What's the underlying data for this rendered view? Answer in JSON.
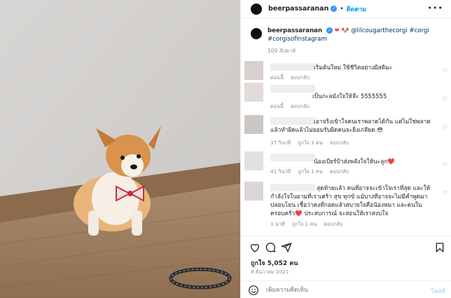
{
  "header": {
    "username": "beerpassaranan",
    "follow_label": "ติดตาม",
    "more_label": "•••"
  },
  "caption": {
    "username": "beerpassaranan",
    "text": " 🐶 @lilcougarthecorgi #corgi #corgisofinstagram",
    "time": "109 สัปดาห์"
  },
  "comments": [
    {
      "text": "เริ่มต้นใหม่ ใช้ชีวิตอย่างมีสติมะ",
      "time": "ตอนนี้",
      "likes": "",
      "reply": "ตอบกลับ"
    },
    {
      "text": "เป็นกะลมังใจให้จ๊ะ 5555555",
      "time": "ตอนนี้",
      "likes": "",
      "reply": "ตอบกลับ"
    },
    {
      "text": "เอาจริงเข้าใจคนเราพลาดได้กัน แต่ไม่ใช่พลาดแล้วทำผิดแล้วไม่ยอมรับผิดคนจะยิ่งเกลียด.😳",
      "time": "37 วินาที",
      "likes": "ถูกใจ 3 คน",
      "reply": "ตอบกลับ"
    },
    {
      "text": "น้องเบียร์ป้าส่งพลังใจให้นะลูก❤️",
      "time": "41 วินาที",
      "likes": "ถูกใจ 1 คน",
      "reply": "ตอบกลับ"
    },
    {
      "text": "สุดท้ายแล้ว คนที่อาจจะเข้าใจเราที่สุด และให้กำลังใจในยามที่เราเศร้า สุข ทุกข์ แม้บางทีอาจจะไม่มีคำพูดมาปลอบโยน เชื่อว่าคงที่กอดแล้วสบายใจคือน้องหมา และคนในครอบครัว❤️ ประสบการณ์ จะสอนให้เราสงบใจ",
      "time": "1 นาที",
      "likes": "ถูกใจ 1 คน",
      "reply": "ตอบกลับ"
    }
  ],
  "footer": {
    "likes": "ถูกใจ 5,052 คน",
    "date": "8 ธันวาคม 2021",
    "input_placeholder": "เพิ่มความคิดเห็น",
    "post_label": "โพสต์"
  },
  "colors": {
    "accent": "#0095f6",
    "heart": "#ed4956",
    "muted": "#8e8e8e"
  }
}
